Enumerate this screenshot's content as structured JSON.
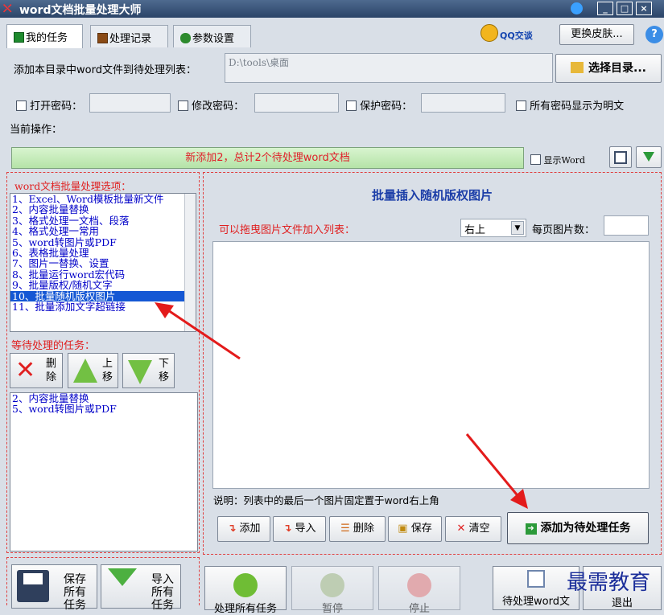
{
  "window": {
    "title": "word文档批量处理大师"
  },
  "tabs": [
    {
      "label": "我的任务"
    },
    {
      "label": "处理记录"
    },
    {
      "label": "参数设置"
    }
  ],
  "header": {
    "qq_label": "QQ交谈",
    "skin_button": "更换皮肤..."
  },
  "directory": {
    "label": "添加本目录中word文件到待处理列表：",
    "path": "D:\\tools\\桌面",
    "choose_button": "选择目录..."
  },
  "passwords": {
    "open_label": "打开密码：",
    "modify_label": "修改密码：",
    "protect_label": "保护密码：",
    "show_plain_label": "所有密码显示为明文"
  },
  "current_op": {
    "label": "当前操作：",
    "status": "新添加2，总计2个待处理word文档",
    "show_word_label": "显示Word"
  },
  "options": {
    "title": "word文档批量处理选项：",
    "items": [
      "1、Excel、Word模板批量新文件",
      "2、内容批量替换",
      "3、格式处理一文档、段落",
      "4、格式处理一常用",
      "5、word转图片或PDF",
      "6、表格批量处理",
      "7、图片一替换、设置",
      "8、批量运行word宏代码",
      "9、批量版权/随机文字",
      "10、批量随机版权图片",
      "11、批量添加文字超链接"
    ],
    "selected": "10、批量随机版权图片"
  },
  "pending": {
    "title": "等待处理的任务：",
    "delete_label": "删除",
    "up_label": "上移",
    "down_label": "下移",
    "items": [
      "2、内容批量替换",
      "5、word转图片或PDF"
    ]
  },
  "panel": {
    "title": "批量插入随机版权图片",
    "drag_label": "可以拖曳图片文件加入列表：",
    "position_value": "右上",
    "per_page_label": "每页图片数：",
    "note": "说明：列表中的最后一个图片固定置于word右上角",
    "add_button": "添加",
    "import_button": "导入",
    "delete_button": "删除",
    "save_button": "保存",
    "clear_button": "清空",
    "add_task_button": "添加为待处理任务"
  },
  "bottom": {
    "save_all": "保存所有任务",
    "import_all": "导入所有任务",
    "start": "处理所有任务",
    "pause": "暂停",
    "stop": "停止",
    "pending_docs": "待处理word文",
    "exit": "退出"
  },
  "watermark": "最需教育"
}
